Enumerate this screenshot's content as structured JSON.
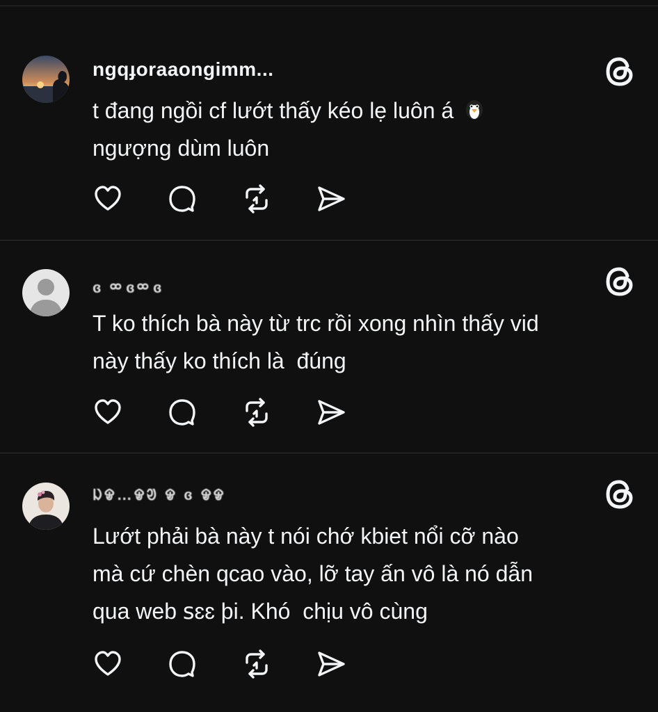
{
  "posts": [
    {
      "username": "ngqɟoraaongimm...",
      "text_line1": "t đang ngồi cf lướt thấy kéo lẹ luôn á",
      "text_line2": "ngượng dùm luôn",
      "emoji": "penguin-icon"
    },
    {
      "username": "ɞ  ᢁ  ɞᢁ  ɞ",
      "text": "T ko thích bà này từ trc rồi xong nhìn thấy vid\nnày thấy ko thích là  đúng"
    },
    {
      "username": "ᱡᱫ…ᱫᱣ  ᱫ ɞ  ᱫᱫ",
      "text": "Lướt phải bà này t nói chớ kbiet nổi cỡ nào\nmà cứ chèn qcao vào, lỡ tay ấn vô là nó dẫn\nqua web ꜱɛɛ þi. Khó  chịu vô cùng"
    }
  ],
  "icons": {
    "like": "heart-icon",
    "reply": "comment-icon",
    "repost": "repost-icon",
    "share": "send-icon",
    "brand": "threads-logo-icon"
  },
  "colors": {
    "background": "#101010",
    "text": "#f3f5f7",
    "divider": "#333333"
  }
}
